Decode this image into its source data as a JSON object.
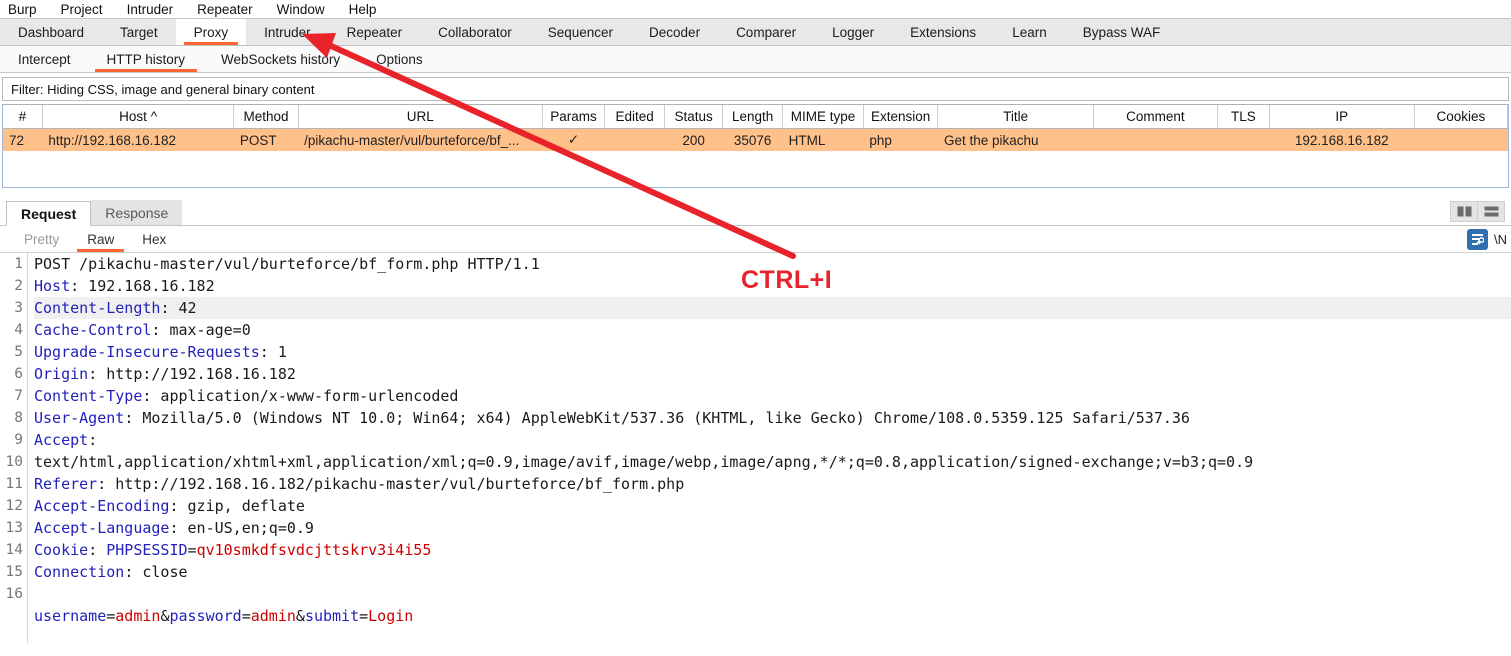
{
  "menubar": {
    "items": [
      "Burp",
      "Project",
      "Intruder",
      "Repeater",
      "Window",
      "Help"
    ]
  },
  "main_tabs": {
    "active": "Proxy",
    "items": [
      "Dashboard",
      "Target",
      "Proxy",
      "Intruder",
      "Repeater",
      "Collaborator",
      "Sequencer",
      "Decoder",
      "Comparer",
      "Logger",
      "Extensions",
      "Learn",
      "Bypass WAF"
    ]
  },
  "sub_tabs": {
    "active": "HTTP history",
    "items": [
      "Intercept",
      "HTTP history",
      "WebSockets history",
      "Options"
    ]
  },
  "filter": {
    "text": "Filter: Hiding CSS, image and general binary content"
  },
  "history_table": {
    "columns": [
      "#",
      "Host",
      "Method",
      "URL",
      "Params",
      "Edited",
      "Status",
      "Length",
      "MIME type",
      "Extension",
      "Title",
      "Comment",
      "TLS",
      "IP",
      "Cookies"
    ],
    "sort_column": "Host",
    "sort_indicator": "^",
    "rows": [
      {
        "num": "72",
        "host": "http://192.168.16.182",
        "method": "POST",
        "url": "/pikachu-master/vul/burteforce/bf_...",
        "params": "✓",
        "edited": "",
        "status": "200",
        "length": "35076",
        "mime": "HTML",
        "extension": "php",
        "title": "Get the pikachu",
        "comment": "",
        "tls": "",
        "ip": "192.168.16.182",
        "cookies": ""
      }
    ]
  },
  "editor": {
    "tabs": [
      "Request",
      "Response"
    ],
    "active_tab": "Request",
    "render_tabs": [
      "Pretty",
      "Raw",
      "Hex"
    ],
    "active_render_tab": "Raw",
    "wrap_label": "\\N",
    "icons": {
      "split_vertical": "split-vertical-icon",
      "split_horizontal": "split-horizontal-icon",
      "wrap": "text-wrap-icon"
    }
  },
  "request": {
    "lines": [
      {
        "n": "1",
        "highlight": false,
        "segments": [
          {
            "t": "POST /pikachu-master/vul/burteforce/bf_form.php HTTP/1.1",
            "c": "val"
          }
        ]
      },
      {
        "n": "2",
        "highlight": false,
        "segments": [
          {
            "t": "Host",
            "c": "hdr"
          },
          {
            "t": ": 192.168.16.182",
            "c": "val"
          }
        ]
      },
      {
        "n": "3",
        "highlight": true,
        "segments": [
          {
            "t": "Content-Length",
            "c": "hdr"
          },
          {
            "t": ": 42",
            "c": "val"
          }
        ]
      },
      {
        "n": "4",
        "highlight": false,
        "segments": [
          {
            "t": "Cache-Control",
            "c": "hdr"
          },
          {
            "t": ": max-age=0",
            "c": "val"
          }
        ]
      },
      {
        "n": "5",
        "highlight": false,
        "segments": [
          {
            "t": "Upgrade-Insecure-Requests",
            "c": "hdr"
          },
          {
            "t": ": 1",
            "c": "val"
          }
        ]
      },
      {
        "n": "6",
        "highlight": false,
        "segments": [
          {
            "t": "Origin",
            "c": "hdr"
          },
          {
            "t": ": http://192.168.16.182",
            "c": "val"
          }
        ]
      },
      {
        "n": "7",
        "highlight": false,
        "segments": [
          {
            "t": "Content-Type",
            "c": "hdr"
          },
          {
            "t": ": application/x-www-form-urlencoded",
            "c": "val"
          }
        ]
      },
      {
        "n": "8",
        "highlight": false,
        "segments": [
          {
            "t": "User-Agent",
            "c": "hdr"
          },
          {
            "t": ": Mozilla/5.0 (Windows NT 10.0; Win64; x64) AppleWebKit/537.36 (KHTML, like Gecko) Chrome/108.0.5359.125 Safari/537.36",
            "c": "val"
          }
        ]
      },
      {
        "n": "9",
        "highlight": false,
        "segments": [
          {
            "t": "Accept",
            "c": "hdr"
          },
          {
            "t": ":",
            "c": "val"
          }
        ]
      },
      {
        "n": "",
        "highlight": false,
        "segments": [
          {
            "t": "text/html,application/xhtml+xml,application/xml;q=0.9,image/avif,image/webp,image/apng,*/*;q=0.8,application/signed-exchange;v=b3;q=0.9",
            "c": "val"
          }
        ]
      },
      {
        "n": "10",
        "highlight": false,
        "segments": [
          {
            "t": "Referer",
            "c": "hdr"
          },
          {
            "t": ": http://192.168.16.182/pikachu-master/vul/burteforce/bf_form.php",
            "c": "val"
          }
        ]
      },
      {
        "n": "11",
        "highlight": false,
        "segments": [
          {
            "t": "Accept-Encoding",
            "c": "hdr"
          },
          {
            "t": ": gzip, deflate",
            "c": "val"
          }
        ]
      },
      {
        "n": "12",
        "highlight": false,
        "segments": [
          {
            "t": "Accept-Language",
            "c": "hdr"
          },
          {
            "t": ": en-US,en;q=0.9",
            "c": "val"
          }
        ]
      },
      {
        "n": "13",
        "highlight": false,
        "segments": [
          {
            "t": "Cookie",
            "c": "hdr"
          },
          {
            "t": ": ",
            "c": "val"
          },
          {
            "t": "PHPSESSID",
            "c": "blue"
          },
          {
            "t": "=",
            "c": "val"
          },
          {
            "t": "qv10smkdfsvdcjttskrv3i4i55",
            "c": "red"
          }
        ]
      },
      {
        "n": "14",
        "highlight": false,
        "segments": [
          {
            "t": "Connection",
            "c": "hdr"
          },
          {
            "t": ": close",
            "c": "val"
          }
        ]
      },
      {
        "n": "15",
        "highlight": false,
        "segments": [
          {
            "t": "",
            "c": "val"
          }
        ]
      },
      {
        "n": "16",
        "highlight": false,
        "segments": [
          {
            "t": "username",
            "c": "blue"
          },
          {
            "t": "=",
            "c": "val"
          },
          {
            "t": "admin",
            "c": "red"
          },
          {
            "t": "&",
            "c": "val"
          },
          {
            "t": "password",
            "c": "blue"
          },
          {
            "t": "=",
            "c": "val"
          },
          {
            "t": "admin",
            "c": "red"
          },
          {
            "t": "&",
            "c": "val"
          },
          {
            "t": "submit",
            "c": "blue"
          },
          {
            "t": "=",
            "c": "val"
          },
          {
            "t": "Login",
            "c": "red"
          }
        ]
      }
    ]
  },
  "annotation": {
    "label": "CTRL+I",
    "color": "#e8232a",
    "arrow_points_to": "Intruder"
  }
}
